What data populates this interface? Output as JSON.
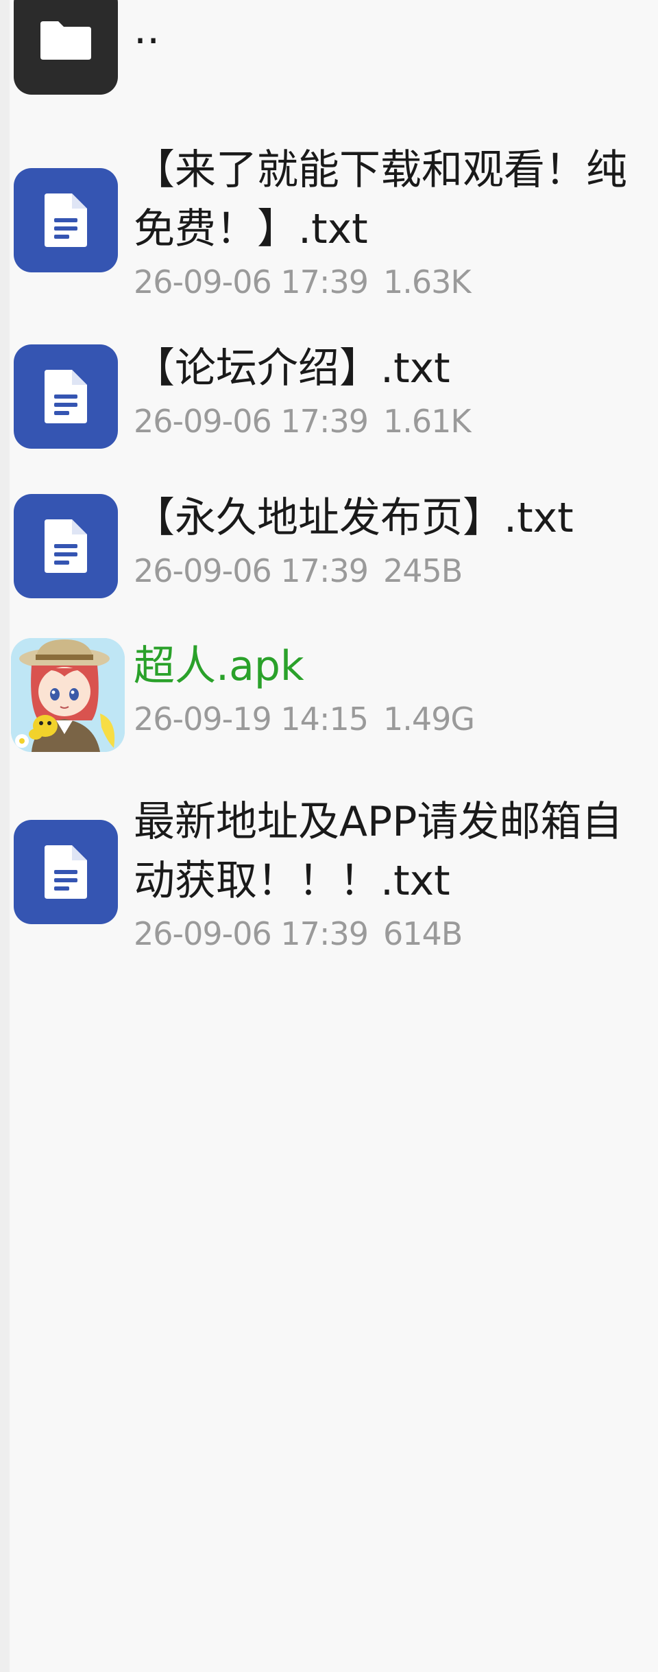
{
  "parent_entry": {
    "label": "..",
    "icon": "folder-icon"
  },
  "files": [
    {
      "name": "【来了就能下载和观看！纯免费！】.txt",
      "date": "26-09-06 17:39",
      "size": "1.63K",
      "icon": "document-icon",
      "type": "txt"
    },
    {
      "name": "【论坛介绍】.txt",
      "date": "26-09-06 17:39",
      "size": "1.61K",
      "icon": "document-icon",
      "type": "txt"
    },
    {
      "name": "【永久地址发布页】.txt",
      "date": "26-09-06 17:39",
      "size": "245B",
      "icon": "document-icon",
      "type": "txt"
    },
    {
      "name": "超人.apk",
      "date": "26-09-19 14:15",
      "size": "1.49G",
      "icon": "app-icon",
      "type": "apk"
    },
    {
      "name": "最新地址及APP请发邮箱自动获取！！！.txt",
      "date": "26-09-06 17:39",
      "size": "614B",
      "icon": "document-icon",
      "type": "txt"
    }
  ],
  "colors": {
    "background": "#f8f8f8",
    "folder_icon_bg": "#2b2b2b",
    "doc_icon_bg": "#3555b2",
    "apk_name": "#2aa12a",
    "meta_text": "#9a9a9a"
  }
}
